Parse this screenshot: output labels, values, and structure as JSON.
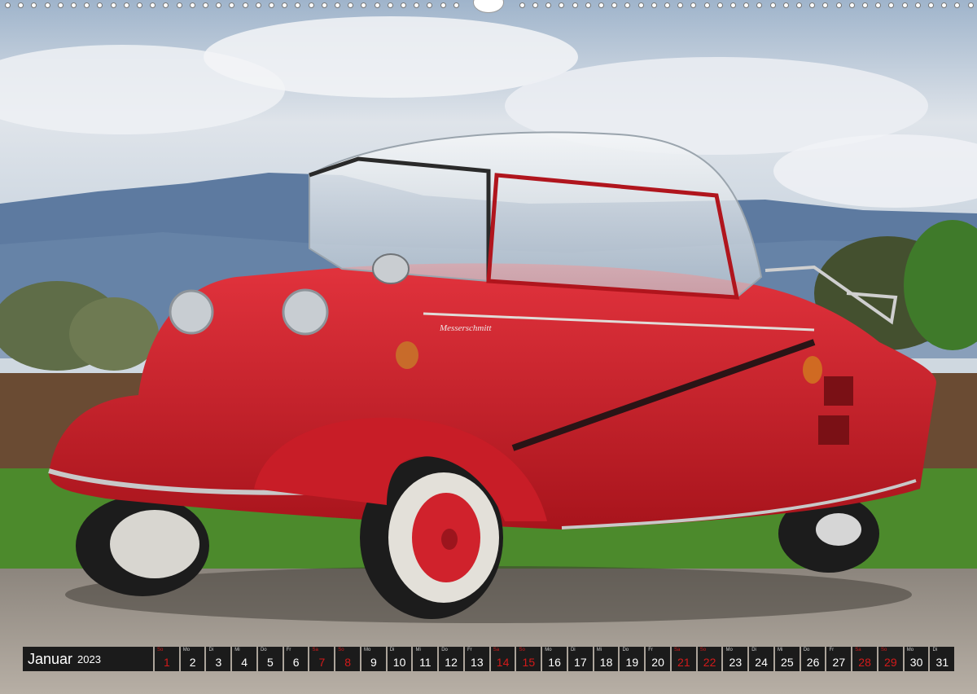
{
  "calendar": {
    "month": "Januar",
    "year": "2023",
    "days": [
      {
        "num": "1",
        "abbr": "So",
        "holiday": true
      },
      {
        "num": "2",
        "abbr": "Mo",
        "holiday": false
      },
      {
        "num": "3",
        "abbr": "Di",
        "holiday": false
      },
      {
        "num": "4",
        "abbr": "Mi",
        "holiday": false
      },
      {
        "num": "5",
        "abbr": "Do",
        "holiday": false
      },
      {
        "num": "6",
        "abbr": "Fr",
        "holiday": false
      },
      {
        "num": "7",
        "abbr": "Sa",
        "holiday": true
      },
      {
        "num": "8",
        "abbr": "So",
        "holiday": true
      },
      {
        "num": "9",
        "abbr": "Mo",
        "holiday": false
      },
      {
        "num": "10",
        "abbr": "Di",
        "holiday": false
      },
      {
        "num": "11",
        "abbr": "Mi",
        "holiday": false
      },
      {
        "num": "12",
        "abbr": "Do",
        "holiday": false
      },
      {
        "num": "13",
        "abbr": "Fr",
        "holiday": false
      },
      {
        "num": "14",
        "abbr": "Sa",
        "holiday": true
      },
      {
        "num": "15",
        "abbr": "So",
        "holiday": true
      },
      {
        "num": "16",
        "abbr": "Mo",
        "holiday": false
      },
      {
        "num": "17",
        "abbr": "Di",
        "holiday": false
      },
      {
        "num": "18",
        "abbr": "Mi",
        "holiday": false
      },
      {
        "num": "19",
        "abbr": "Do",
        "holiday": false
      },
      {
        "num": "20",
        "abbr": "Fr",
        "holiday": false
      },
      {
        "num": "21",
        "abbr": "Sa",
        "holiday": true
      },
      {
        "num": "22",
        "abbr": "So",
        "holiday": true
      },
      {
        "num": "23",
        "abbr": "Mo",
        "holiday": false
      },
      {
        "num": "24",
        "abbr": "Di",
        "holiday": false
      },
      {
        "num": "25",
        "abbr": "Mi",
        "holiday": false
      },
      {
        "num": "26",
        "abbr": "Do",
        "holiday": false
      },
      {
        "num": "27",
        "abbr": "Fr",
        "holiday": false
      },
      {
        "num": "28",
        "abbr": "Sa",
        "holiday": true
      },
      {
        "num": "29",
        "abbr": "So",
        "holiday": true
      },
      {
        "num": "30",
        "abbr": "Mo",
        "holiday": false
      },
      {
        "num": "31",
        "abbr": "Di",
        "holiday": false
      }
    ]
  },
  "photo": {
    "subject": "red-bubble-car",
    "badge_text": "Messerschmitt"
  },
  "colors": {
    "car_red": "#d0222c",
    "holiday_red": "#d31a1a",
    "bar_dark": "#1b1b1b"
  }
}
